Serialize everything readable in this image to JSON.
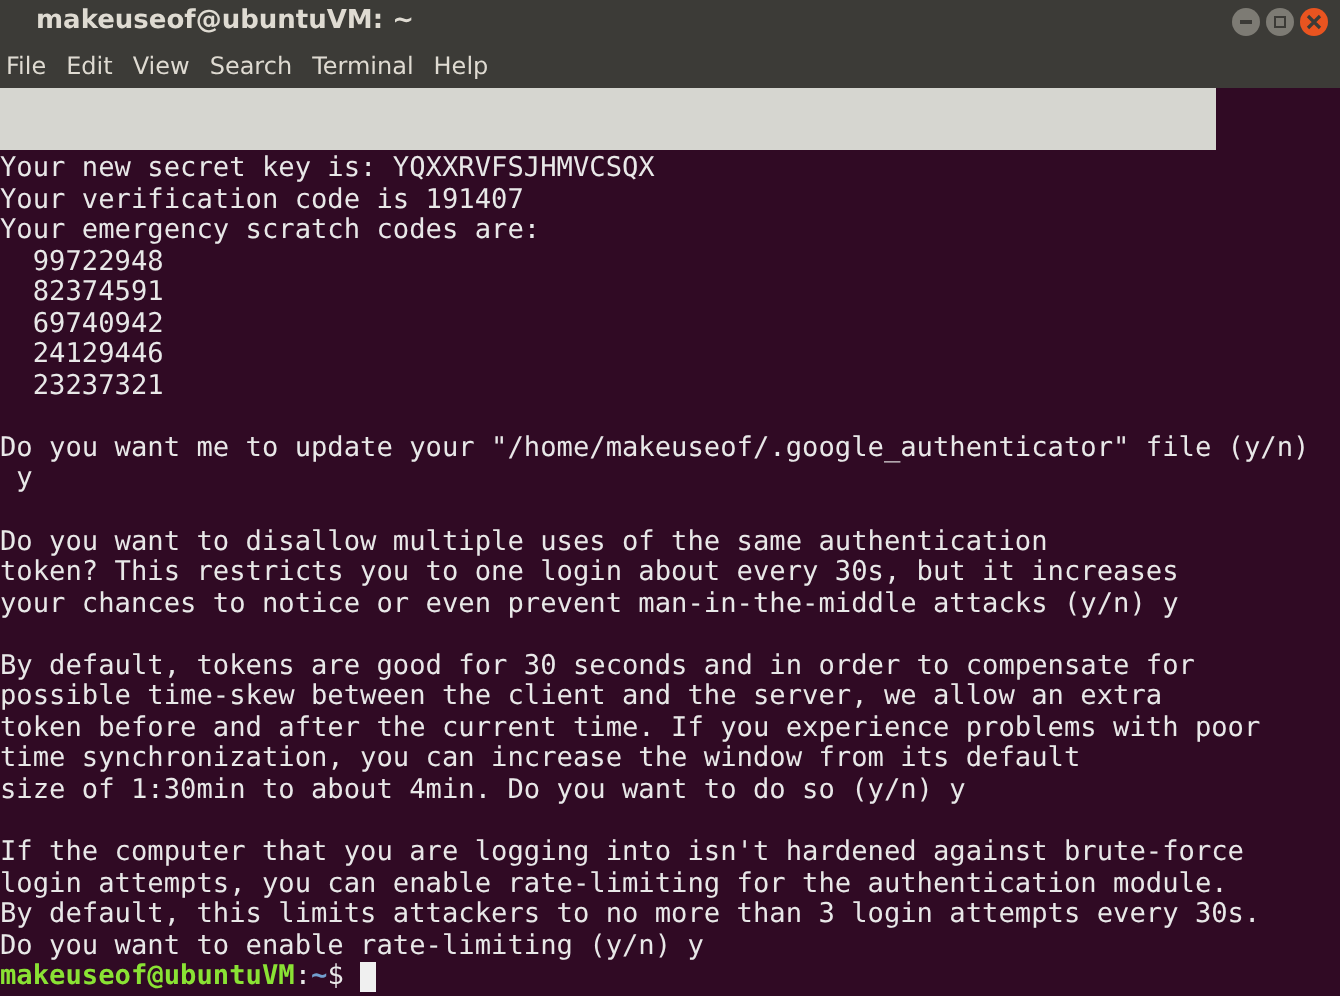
{
  "window": {
    "title": "makeuseof@ubuntuVM: ~"
  },
  "menu": [
    "File",
    "Edit",
    "View",
    "Search",
    "Terminal",
    "Help"
  ],
  "terminal": {
    "blocks": [
      [
        "Your new secret key is: YQXXRVFSJHMVCSQX",
        "Your verification code is 191407",
        "Your emergency scratch codes are:",
        "  99722948",
        "  82374591",
        "  69740942",
        "  24129446",
        "  23237321"
      ],
      [
        "Do you want me to update your \"/home/makeuseof/.google_authenticator\" file (y/n)",
        " y"
      ],
      [
        "Do you want to disallow multiple uses of the same authentication",
        "token? This restricts you to one login about every 30s, but it increases",
        "your chances to notice or even prevent man-in-the-middle attacks (y/n) y"
      ],
      [
        "By default, tokens are good for 30 seconds and in order to compensate for",
        "possible time-skew between the client and the server, we allow an extra",
        "token before and after the current time. If you experience problems with poor",
        "time synchronization, you can increase the window from its default",
        "size of 1:30min to about 4min. Do you want to do so (y/n) y"
      ],
      [
        "If the computer that you are logging into isn't hardened against brute-force",
        "login attempts, you can enable rate-limiting for the authentication module.",
        "By default, this limits attackers to no more than 3 login attempts every 30s.",
        "Do you want to enable rate-limiting (y/n) y"
      ]
    ],
    "prompt": {
      "user_host": "makeuseof@ubuntuVM",
      "separator": ":",
      "path": "~",
      "symbol": "$"
    }
  }
}
